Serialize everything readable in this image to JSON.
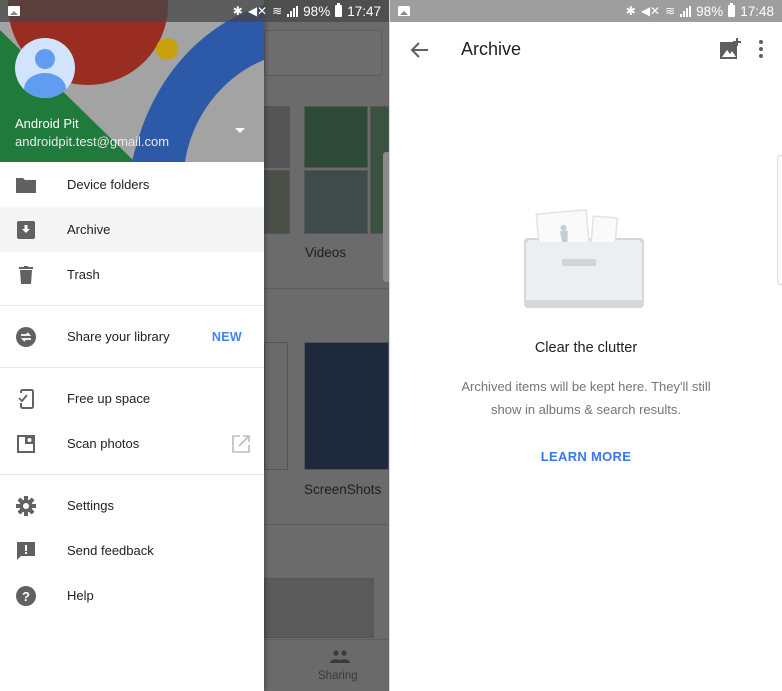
{
  "left_screen": {
    "status_bar": {
      "notification_icon": "image-icon",
      "icons": [
        "bluetooth-icon",
        "mute-icon",
        "wifi-icon",
        "signal-icon"
      ],
      "battery": "98%",
      "time": "17:47"
    },
    "drawer": {
      "account": {
        "name": "Android Pit",
        "email": "androidpit.test@gmail.com"
      },
      "items": [
        {
          "label": "Device folders",
          "icon": "folder-icon"
        },
        {
          "label": "Archive",
          "icon": "archive-icon",
          "active": true
        },
        {
          "label": "Trash",
          "icon": "trash-icon"
        },
        {
          "label": "Share your library",
          "icon": "share-library-icon",
          "badge": "NEW"
        },
        {
          "label": "Free up space",
          "icon": "free-space-icon"
        },
        {
          "label": "Scan photos",
          "icon": "scan-photos-icon",
          "trailing_icon": "open-external-icon"
        },
        {
          "label": "Settings",
          "icon": "settings-icon"
        },
        {
          "label": "Send feedback",
          "icon": "feedback-icon"
        },
        {
          "label": "Help",
          "icon": "help-icon"
        }
      ]
    },
    "background": {
      "album_labels": [
        "Videos",
        "ScreenShots"
      ],
      "bottom_nav_label": "Sharing"
    }
  },
  "right_screen": {
    "status_bar": {
      "notification_icon": "image-icon",
      "icons": [
        "bluetooth-icon",
        "mute-icon",
        "wifi-icon",
        "signal-icon"
      ],
      "battery": "98%",
      "time": "17:48"
    },
    "app_bar": {
      "title": "Archive",
      "back_icon": "arrow-back-icon",
      "actions": [
        "add-photo-icon",
        "more-vert-icon"
      ]
    },
    "empty_state": {
      "title": "Clear the clutter",
      "description": "Archived items will be kept here. They'll still show in albums & search results.",
      "action_label": "LEARN MORE"
    }
  },
  "colors": {
    "accent": "#4285f4",
    "link": "#3b78e7",
    "icon_gray": "#616161"
  }
}
